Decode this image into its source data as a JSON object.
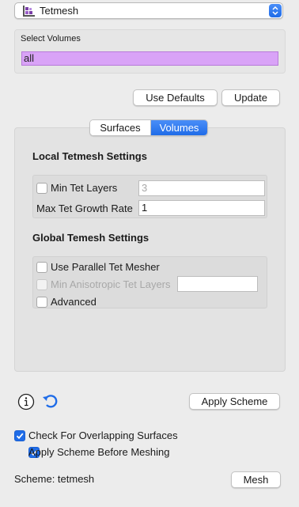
{
  "scheme_selector": {
    "value": "Tetmesh",
    "icon": "tetmesh-icon"
  },
  "select_volumes": {
    "label": "Select Volumes",
    "value": "all"
  },
  "buttons": {
    "use_defaults": "Use Defaults",
    "update": "Update",
    "apply_scheme": "Apply Scheme",
    "mesh": "Mesh"
  },
  "tabs": [
    {
      "label": "Surfaces",
      "active": false
    },
    {
      "label": "Volumes",
      "active": true
    }
  ],
  "local_settings": {
    "title": "Local Tetmesh Settings",
    "min_tet_layers": {
      "label": "Min Tet Layers",
      "checked": false,
      "value": "3"
    },
    "max_tet_growth_rate": {
      "label": "Max Tet Growth Rate",
      "value": "1"
    }
  },
  "global_settings": {
    "title": "Global Temesh Settings",
    "use_parallel": {
      "label": "Use Parallel Tet Mesher",
      "checked": false
    },
    "min_aniso": {
      "label": "Min Anisotropic Tet Layers",
      "checked": false,
      "enabled": false,
      "value": ""
    },
    "advanced": {
      "label": "Advanced",
      "checked": false
    }
  },
  "options": {
    "check_overlap": {
      "label": "Check For Overlapping Surfaces",
      "checked": true
    },
    "apply_before_meshing": {
      "label": "Apply Scheme Before Meshing",
      "checked": true
    }
  },
  "status": {
    "scheme_text": "Scheme: tetmesh"
  },
  "colors": {
    "accent": "#1f6ce8",
    "volume_field": "#d9a3f7",
    "tetmesh_icon": "#7b3fa8"
  }
}
